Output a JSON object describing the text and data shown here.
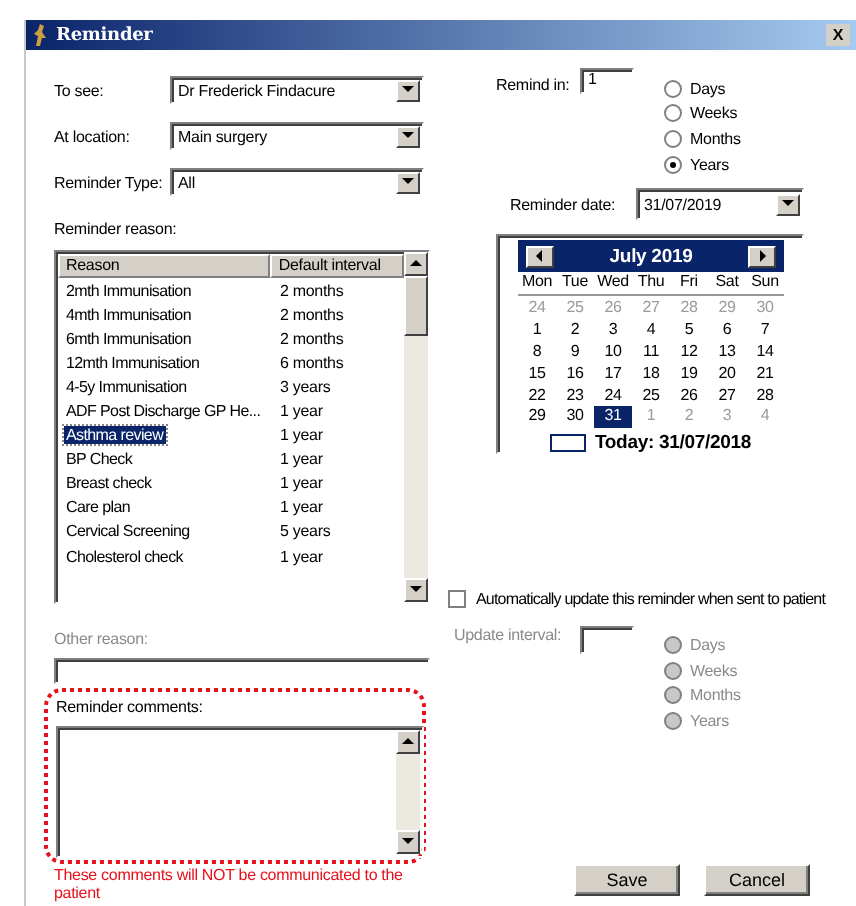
{
  "window": {
    "title": "Reminder",
    "close": "X"
  },
  "to_see": {
    "label": "To see:",
    "value": "Dr Frederick Findacure"
  },
  "at_location": {
    "label": "At location:",
    "value": "Main surgery"
  },
  "reminder_type": {
    "label": "Reminder Type:",
    "value": "All"
  },
  "reminder_reason": {
    "label": "Reminder reason:",
    "columns": [
      "Reason",
      "Default interval"
    ],
    "rows": [
      {
        "reason": "2mth Immunisation",
        "interval": "2 months",
        "selected": false
      },
      {
        "reason": "4mth Immunisation",
        "interval": "2 months",
        "selected": false
      },
      {
        "reason": "6mth Immunisation",
        "interval": "2 months",
        "selected": false
      },
      {
        "reason": "12mth Immunisation",
        "interval": "6 months",
        "selected": false
      },
      {
        "reason": "4-5y Immunisation",
        "interval": "3 years",
        "selected": false
      },
      {
        "reason": "ADF Post Discharge GP He...",
        "interval": "1 year",
        "selected": false
      },
      {
        "reason": "Asthma review",
        "interval": "1 year",
        "selected": true
      },
      {
        "reason": "BP Check",
        "interval": "1 year",
        "selected": false
      },
      {
        "reason": "Breast check",
        "interval": "1 year",
        "selected": false
      },
      {
        "reason": "Care plan",
        "interval": "1 year",
        "selected": false
      },
      {
        "reason": "Cervical Screening",
        "interval": "5 years",
        "selected": false
      },
      {
        "reason": "Cholesterol check",
        "interval": "1 year",
        "selected": false
      }
    ]
  },
  "other_reason": {
    "label": "Other reason:",
    "disabled": true
  },
  "reminder_comments": {
    "label": "Reminder comments:",
    "note": "These comments will NOT be communicated to the patient"
  },
  "remind_in": {
    "label": "Remind in:",
    "value": "1",
    "units": [
      {
        "label": "Days",
        "selected": false
      },
      {
        "label": "Weeks",
        "selected": false
      },
      {
        "label": "Months",
        "selected": false
      },
      {
        "label": "Years",
        "selected": true
      }
    ]
  },
  "reminder_date": {
    "label": "Reminder date:",
    "value": "31/07/2019"
  },
  "calendar": {
    "month": "July 2019",
    "weekdays": [
      "Mon",
      "Tue",
      "Wed",
      "Thu",
      "Fri",
      "Sat",
      "Sun"
    ],
    "weeks": [
      [
        {
          "day": "24",
          "other_month": true,
          "selected": false
        },
        {
          "day": "25",
          "other_month": true,
          "selected": false
        },
        {
          "day": "26",
          "other_month": true,
          "selected": false
        },
        {
          "day": "27",
          "other_month": true,
          "selected": false
        },
        {
          "day": "28",
          "other_month": true,
          "selected": false
        },
        {
          "day": "29",
          "other_month": true,
          "selected": false
        },
        {
          "day": "30",
          "other_month": true,
          "selected": false
        }
      ],
      [
        {
          "day": "1",
          "other_month": false,
          "selected": false
        },
        {
          "day": "2",
          "other_month": false,
          "selected": false
        },
        {
          "day": "3",
          "other_month": false,
          "selected": false
        },
        {
          "day": "4",
          "other_month": false,
          "selected": false
        },
        {
          "day": "5",
          "other_month": false,
          "selected": false
        },
        {
          "day": "6",
          "other_month": false,
          "selected": false
        },
        {
          "day": "7",
          "other_month": false,
          "selected": false
        }
      ],
      [
        {
          "day": "8",
          "other_month": false,
          "selected": false
        },
        {
          "day": "9",
          "other_month": false,
          "selected": false
        },
        {
          "day": "10",
          "other_month": false,
          "selected": false
        },
        {
          "day": "11",
          "other_month": false,
          "selected": false
        },
        {
          "day": "12",
          "other_month": false,
          "selected": false
        },
        {
          "day": "13",
          "other_month": false,
          "selected": false
        },
        {
          "day": "14",
          "other_month": false,
          "selected": false
        }
      ],
      [
        {
          "day": "15",
          "other_month": false,
          "selected": false
        },
        {
          "day": "16",
          "other_month": false,
          "selected": false
        },
        {
          "day": "17",
          "other_month": false,
          "selected": false
        },
        {
          "day": "18",
          "other_month": false,
          "selected": false
        },
        {
          "day": "19",
          "other_month": false,
          "selected": false
        },
        {
          "day": "20",
          "other_month": false,
          "selected": false
        },
        {
          "day": "21",
          "other_month": false,
          "selected": false
        }
      ],
      [
        {
          "day": "22",
          "other_month": false,
          "selected": false
        },
        {
          "day": "23",
          "other_month": false,
          "selected": false
        },
        {
          "day": "24",
          "other_month": false,
          "selected": false
        },
        {
          "day": "25",
          "other_month": false,
          "selected": false
        },
        {
          "day": "26",
          "other_month": false,
          "selected": false
        },
        {
          "day": "27",
          "other_month": false,
          "selected": false
        },
        {
          "day": "28",
          "other_month": false,
          "selected": false
        }
      ],
      [
        {
          "day": "29",
          "other_month": false,
          "selected": false
        },
        {
          "day": "30",
          "other_month": false,
          "selected": false
        },
        {
          "day": "31",
          "other_month": false,
          "selected": true
        },
        {
          "day": "1",
          "other_month": true,
          "selected": false
        },
        {
          "day": "2",
          "other_month": true,
          "selected": false
        },
        {
          "day": "3",
          "other_month": true,
          "selected": false
        },
        {
          "day": "4",
          "other_month": true,
          "selected": false
        }
      ]
    ],
    "today": "Today: 31/07/2018"
  },
  "auto_update": {
    "label": "Automatically update this reminder when sent to patient",
    "checked": false
  },
  "update_interval": {
    "label": "Update interval:",
    "disabled": true,
    "units": [
      {
        "label": "Days",
        "selected": false
      },
      {
        "label": "Weeks",
        "selected": false
      },
      {
        "label": "Months",
        "selected": false
      },
      {
        "label": "Years",
        "selected": false
      }
    ]
  },
  "buttons": [
    {
      "label": "Save"
    },
    {
      "label": "Cancel"
    }
  ]
}
